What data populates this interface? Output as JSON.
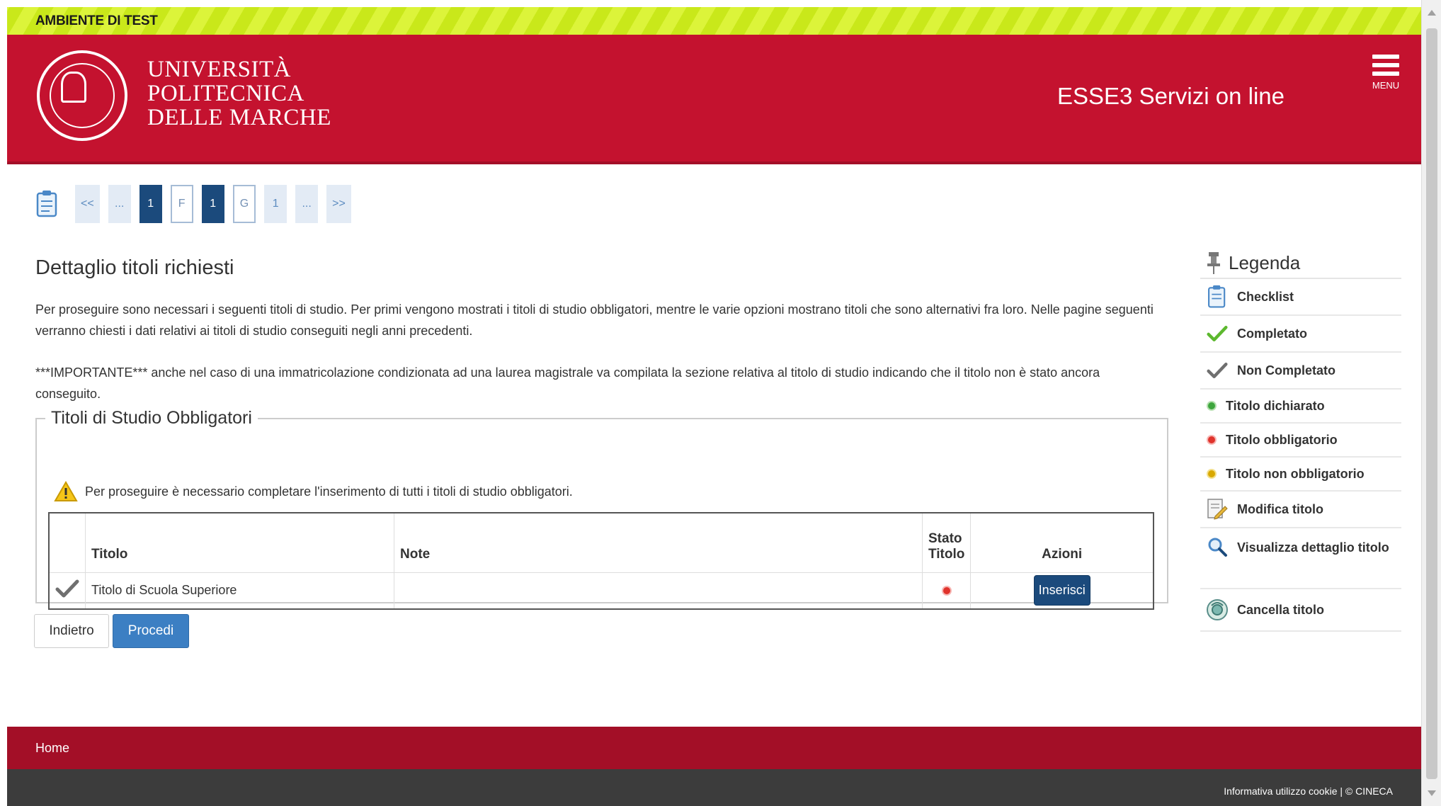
{
  "banner": {
    "text": "AMBIENTE DI TEST"
  },
  "header": {
    "logo_line1": "UNIVERSITÀ",
    "logo_line2": "POLITECNICA",
    "logo_line3": "DELLE MARCHE",
    "service_title": "ESSE3 Servizi on line",
    "menu_label": "MENU",
    "brand_color": "#c4122f"
  },
  "pager": {
    "items": [
      "<<",
      "...",
      "1",
      "F",
      "1",
      "G",
      "1",
      "...",
      ">>"
    ]
  },
  "main": {
    "title": "Dettaglio titoli richiesti",
    "intro": "Per proseguire sono necessari i seguenti titoli di studio. Per primi vengono mostrati i titoli di studio obbligatori, mentre le varie opzioni mostrano titoli che sono alternativi fra loro. Nelle pagine seguenti verranno chiesti i dati relativi ai titoli di studio conseguiti negli anni precedenti.",
    "important": "***IMPORTANTE*** anche nel caso di una immatricolazione condizionata ad una laurea magistrale va compilata la sezione relativa al titolo di studio indicando che il titolo non è stato ancora conseguito.",
    "fieldset_legend": "Titoli di Studio Obbligatori",
    "warning": "Per proseguire è necessario completare l'inserimento di tutti i titoli di studio obbligatori.",
    "table": {
      "headers": {
        "titolo": "Titolo",
        "note": "Note",
        "stato_1": "Stato",
        "stato_2": "Titolo",
        "azioni": "Azioni"
      },
      "rows": [
        {
          "titolo": "Titolo di Scuola Superiore",
          "note": "",
          "action": "Inserisci"
        }
      ]
    },
    "back_label": "Indietro",
    "proceed_label": "Procedi"
  },
  "legend": {
    "title": "Legenda",
    "items": [
      {
        "label": "Checklist",
        "icon": "checklist-icon"
      },
      {
        "label": "Completato",
        "icon": "green-check-icon"
      },
      {
        "label": "Non Completato",
        "icon": "gray-check-icon"
      },
      {
        "label": "Titolo dichiarato",
        "icon": "green-dot-icon"
      },
      {
        "label": "Titolo obbligatorio",
        "icon": "red-dot-icon"
      },
      {
        "label": "Titolo non obbligatorio",
        "icon": "yellow-dot-icon"
      },
      {
        "label": "Modifica titolo",
        "icon": "edit-icon"
      },
      {
        "label": "Visualizza dettaglio titolo",
        "icon": "magnifier-icon"
      },
      {
        "label": "Cancella titolo",
        "icon": "delete-icon"
      }
    ]
  },
  "footer": {
    "home": "Home",
    "cookie": "Informativa utilizzo cookie | © CINECA"
  }
}
